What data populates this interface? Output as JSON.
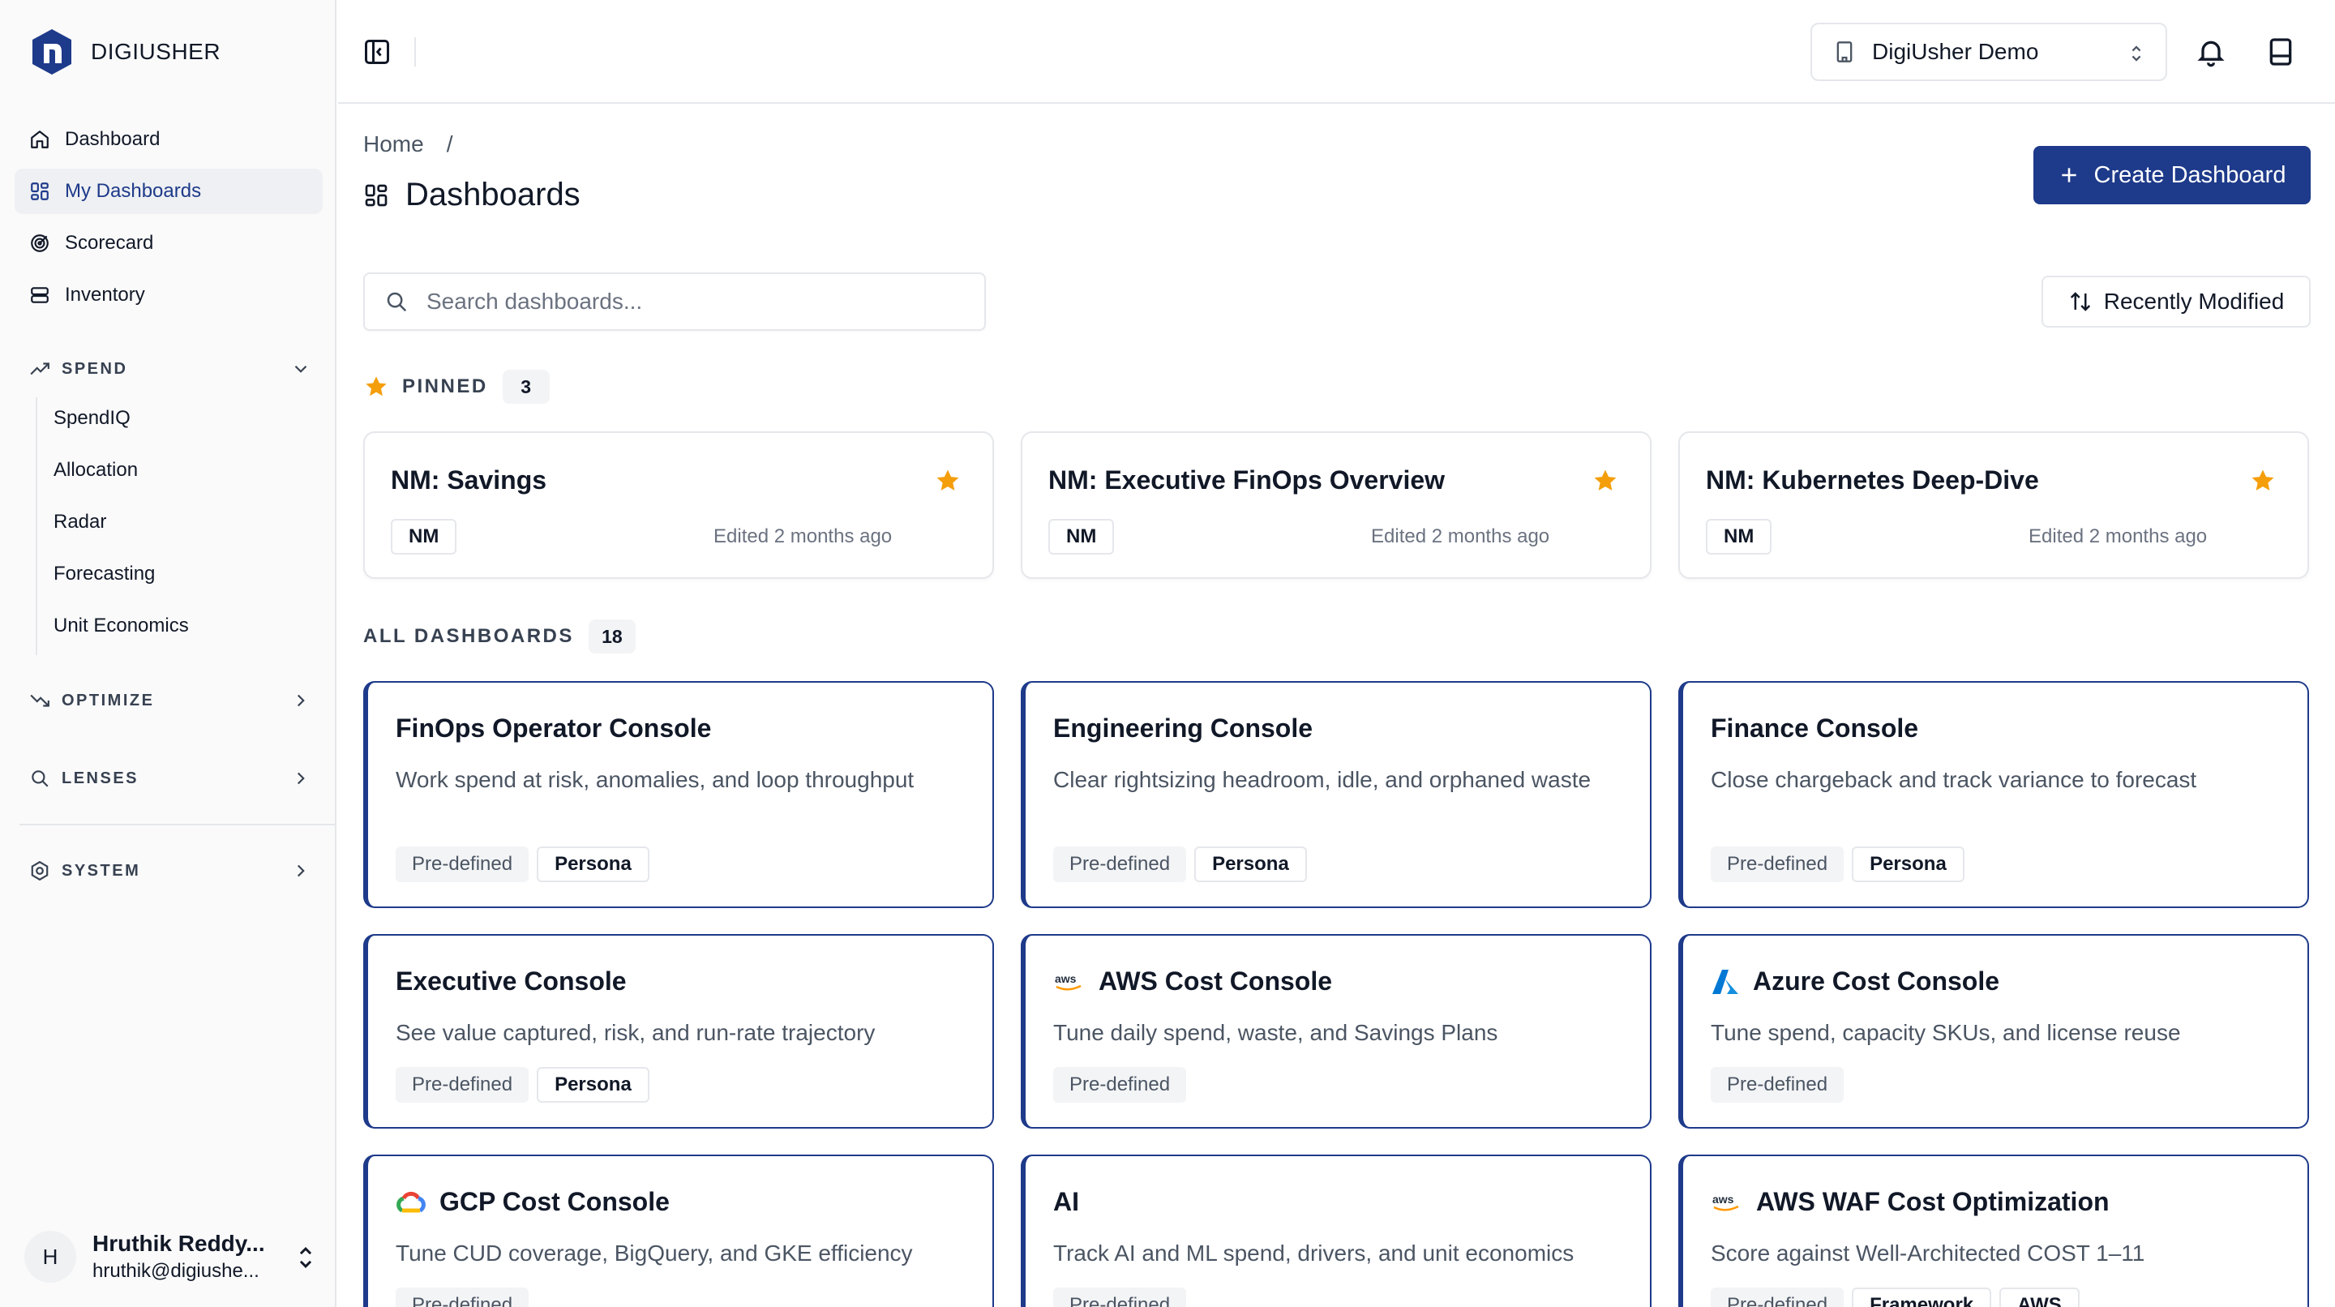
{
  "brand": {
    "name": "DIGIUSHER"
  },
  "sidebar": {
    "items": [
      {
        "label": "Dashboard",
        "icon": "home-icon"
      },
      {
        "label": "My Dashboards",
        "icon": "grid-icon",
        "active": true
      },
      {
        "label": "Scorecard",
        "icon": "target-icon"
      },
      {
        "label": "Inventory",
        "icon": "database-icon"
      }
    ],
    "sections": {
      "spend": {
        "label": "SPEND",
        "expanded": true,
        "children": [
          "SpendIQ",
          "Allocation",
          "Radar",
          "Forecasting",
          "Unit Economics"
        ]
      },
      "optimize": {
        "label": "OPTIMIZE",
        "expanded": false
      },
      "lenses": {
        "label": "LENSES",
        "expanded": false
      },
      "system": {
        "label": "SYSTEM",
        "expanded": false
      }
    },
    "user": {
      "initial": "H",
      "name": "Hruthik Reddy...",
      "email": "hruthik@digiushe..."
    }
  },
  "header": {
    "org": "DigiUsher Demo"
  },
  "breadcrumb": {
    "home": "Home",
    "sep": "/"
  },
  "page": {
    "title": "Dashboards",
    "create_label": "Create Dashboard",
    "search_placeholder": "Search dashboards...",
    "sort_label": "Recently Modified"
  },
  "pinned": {
    "label": "PINNED",
    "count": "3",
    "cards": [
      {
        "title": "NM: Savings",
        "tag": "NM",
        "edited": "Edited 2 months ago"
      },
      {
        "title": "NM: Executive FinOps Overview",
        "tag": "NM",
        "edited": "Edited 2 months ago"
      },
      {
        "title": "NM: Kubernetes Deep-Dive",
        "tag": "NM",
        "edited": "Edited 2 months ago"
      }
    ]
  },
  "all": {
    "label": "ALL DASHBOARDS",
    "count": "18",
    "cards": [
      {
        "title": "FinOps Operator Console",
        "desc": "Work spend at risk, anomalies, and loop throughput",
        "tags": [
          "Pre-defined",
          "Persona"
        ]
      },
      {
        "title": "Engineering Console",
        "desc": "Clear rightsizing headroom, idle, and orphaned waste",
        "tags": [
          "Pre-defined",
          "Persona"
        ]
      },
      {
        "title": "Finance Console",
        "desc": "Close chargeback and track variance to forecast",
        "tags": [
          "Pre-defined",
          "Persona"
        ]
      },
      {
        "title": "Executive Console",
        "desc": "See value captured, risk, and run-rate trajectory",
        "tags": [
          "Pre-defined",
          "Persona"
        ]
      },
      {
        "title": "AWS Cost Console",
        "desc": "Tune daily spend, waste, and Savings Plans",
        "tags": [
          "Pre-defined"
        ],
        "provider": "aws"
      },
      {
        "title": "Azure Cost Console",
        "desc": "Tune spend, capacity SKUs, and license reuse",
        "tags": [
          "Pre-defined"
        ],
        "provider": "azure"
      },
      {
        "title": "GCP Cost Console",
        "desc": "Tune CUD coverage, BigQuery, and GKE efficiency",
        "tags": [
          "Pre-defined"
        ],
        "provider": "gcp"
      },
      {
        "title": "AI",
        "desc": "Track AI and ML spend, drivers, and unit economics",
        "tags": [
          "Pre-defined"
        ]
      },
      {
        "title": "AWS WAF Cost Optimization",
        "desc": "Score against Well-Architected COST 1–11",
        "tags": [
          "Pre-defined",
          "Framework",
          "AWS"
        ],
        "provider": "aws"
      }
    ]
  },
  "colors": {
    "accent": "#1e3a8a",
    "star": "#f59e0b",
    "border": "#e5e7eb"
  },
  "provider_logos": {
    "aws_text": "aws"
  }
}
